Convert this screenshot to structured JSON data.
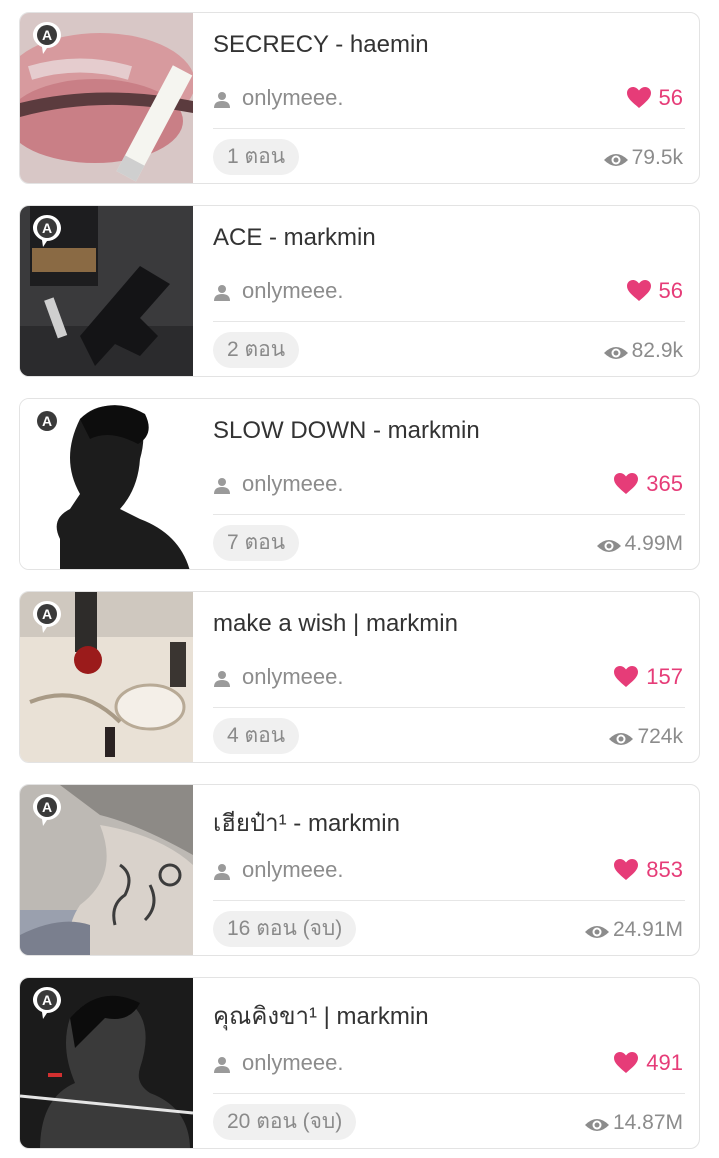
{
  "accent_color": "#e63c78",
  "badge_letter": "A",
  "stories": [
    {
      "title": "SECRECY - haemin",
      "author": "onlymeee.",
      "likes": "56",
      "episodes": "1 ตอน",
      "views": "79.5k",
      "cover_icon": "lips-cigarette-image"
    },
    {
      "title": "ACE - markmin",
      "author": "onlymeee.",
      "likes": "56",
      "episodes": "2 ตอน",
      "views": "82.9k",
      "cover_icon": "gun-bottle-image"
    },
    {
      "title": "SLOW DOWN - markmin",
      "author": "onlymeee.",
      "likes": "365",
      "episodes": "7 ตอน",
      "views": "4.99M",
      "cover_icon": "portrait-silhouette-image"
    },
    {
      "title": "make a wish | markmin",
      "author": "onlymeee.",
      "likes": "157",
      "episodes": "4 ตอน",
      "views": "724k",
      "cover_icon": "champagne-jewelry-image"
    },
    {
      "title": "เฮียป๋า¹ - markmin",
      "author": "onlymeee.",
      "likes": "853",
      "episodes": "16 ตอน (จบ)",
      "views": "24.91M",
      "cover_icon": "tattooed-arm-image"
    },
    {
      "title": "คุณคิงขา¹ | markmin",
      "author": "onlymeee.",
      "likes": "491",
      "episodes": "20 ตอน (จบ)",
      "views": "14.87M",
      "cover_icon": "dark-portrait-image"
    }
  ]
}
